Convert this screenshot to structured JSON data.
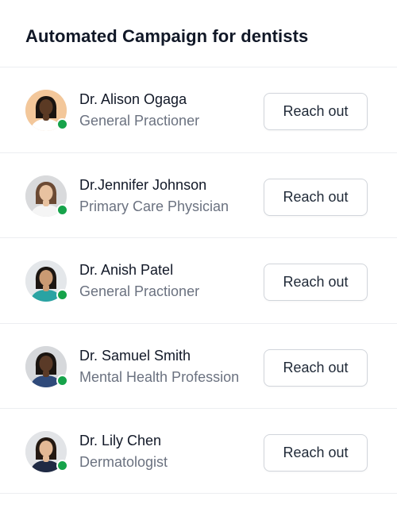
{
  "header": {
    "title": "Automated Campaign for dentists"
  },
  "status_color": "#16a34a",
  "doctors": [
    {
      "name": "Dr. Alison Ogaga",
      "role": "General Practioner",
      "button_label": "Reach out",
      "avatar_bg": "#f3c79a",
      "skin": "#5b3a24",
      "hair": "#1a1410",
      "shirt": "#ffffff",
      "status": "online"
    },
    {
      "name": "Dr.Jennifer Johnson",
      "role": "Primary Care Physician",
      "button_label": "Reach out",
      "avatar_bg": "#d9dadc",
      "skin": "#e8c2a0",
      "hair": "#6b4a34",
      "shirt": "#f5f5f5",
      "status": "online"
    },
    {
      "name": "Dr. Anish Patel",
      "role": "General Practioner",
      "button_label": "Reach out",
      "avatar_bg": "#e4e7ea",
      "skin": "#c99a73",
      "hair": "#1c1612",
      "shirt": "#2aa3a3",
      "status": "online"
    },
    {
      "name": "Dr. Samuel Smith",
      "role": "Mental Health Professional",
      "button_label": "Reach out",
      "avatar_bg": "#d6d8db",
      "skin": "#5a3a27",
      "hair": "#1a1410",
      "shirt": "#2f4a7a",
      "status": "online"
    },
    {
      "name": "Dr. Lily Chen",
      "role": "Dermatologist",
      "button_label": "Reach out",
      "avatar_bg": "#e2e4e7",
      "skin": "#e3b995",
      "hair": "#241912",
      "shirt": "#1f2a44",
      "status": "online"
    }
  ]
}
